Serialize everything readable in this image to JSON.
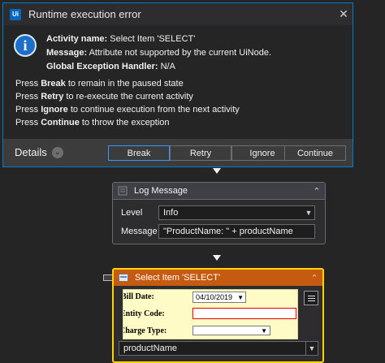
{
  "dialog": {
    "title": "Runtime execution error",
    "logo_text": "Ui",
    "icons": {
      "logo": "uipath-logo-icon",
      "info": "info-icon",
      "close": "close-icon",
      "details_toggle": "chevron-down-icon"
    },
    "activity_label": "Activity name:",
    "activity_value": "Select Item 'SELECT'",
    "message_label": "Message:",
    "message_value": "Attribute not supported by the current UiNode.",
    "handler_label": "Global Exception Handler:",
    "handler_value": "N/A",
    "instructions": [
      {
        "prefix": "Press ",
        "key": "Break",
        "suffix": " to remain in the paused state"
      },
      {
        "prefix": "Press ",
        "key": "Retry",
        "suffix": " to re-execute the current activity"
      },
      {
        "prefix": "Press ",
        "key": "Ignore",
        "suffix": " to continue execution from the next activity"
      },
      {
        "prefix": "Press ",
        "key": "Continue",
        "suffix": " to throw the exception"
      }
    ],
    "details_label": "Details",
    "buttons": {
      "break": "Break",
      "retry": "Retry",
      "ignore": "Ignore",
      "continue": "Continue"
    },
    "close_glyph": "✕",
    "info_glyph": "i",
    "toggle_glyph": "⌄"
  },
  "log_message": {
    "title": "Log Message",
    "collapse_glyph": "⌃",
    "level_label": "Level",
    "level_value": "Info",
    "message_label": "Message",
    "message_value": "\"ProductName: \" + productName"
  },
  "select_item": {
    "title": "Select Item 'SELECT'",
    "collapse_glyph": "⌃",
    "preview": {
      "bill_date_label": "Bill Date:",
      "bill_date_value": "04/10/2019",
      "entity_code_label": "Entity Code:",
      "charge_type_label": "Charge Type:"
    },
    "item_value": "productName"
  },
  "colors": {
    "accent": "#007acc",
    "select_highlight": "#ffd400",
    "select_header": "#c55a11"
  }
}
